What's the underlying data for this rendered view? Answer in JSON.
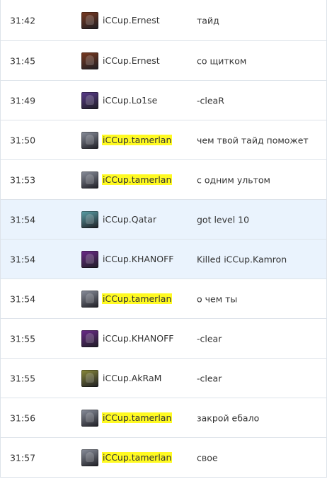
{
  "rows": [
    {
      "time": "31:42",
      "player": "iCCup.Ernest",
      "message": "тайд",
      "icon": "hero-icon-ernest",
      "highlight": false,
      "system": false,
      "color": "#7a3a20"
    },
    {
      "time": "31:45",
      "player": "iCCup.Ernest",
      "message": "со щитком",
      "icon": "hero-icon-ernest",
      "highlight": false,
      "system": false,
      "color": "#7a3a20"
    },
    {
      "time": "31:49",
      "player": "iCCup.Lo1se",
      "message": "-cleaR",
      "icon": "hero-icon-lo1se",
      "highlight": false,
      "system": false,
      "color": "#5a3b8c"
    },
    {
      "time": "31:50",
      "player": "iCCup.tamerlan",
      "message": "чем твой тайд поможет",
      "icon": "hero-icon-tamerlan",
      "highlight": true,
      "system": false,
      "color": "#8a8f9c"
    },
    {
      "time": "31:53",
      "player": "iCCup.tamerlan",
      "message": "с одним ультом",
      "icon": "hero-icon-tamerlan",
      "highlight": true,
      "system": false,
      "color": "#8a8f9c"
    },
    {
      "time": "31:54",
      "player": "iCCup.Qatar",
      "message": "got level 10",
      "icon": "hero-icon-qatar",
      "highlight": false,
      "system": true,
      "color": "#5aa0a8"
    },
    {
      "time": "31:54",
      "player": "iCCup.KHANOFF",
      "message": "Killed iCCup.Kamron",
      "icon": "hero-icon-khanoff",
      "highlight": false,
      "system": true,
      "color": "#6b2a8a"
    },
    {
      "time": "31:54",
      "player": "iCCup.tamerlan",
      "message": "о чем ты",
      "icon": "hero-icon-tamerlan",
      "highlight": true,
      "system": false,
      "color": "#8a8f9c"
    },
    {
      "time": "31:55",
      "player": "iCCup.KHANOFF",
      "message": "-clear",
      "icon": "hero-icon-khanoff",
      "highlight": false,
      "system": false,
      "color": "#6b2a8a"
    },
    {
      "time": "31:55",
      "player": "iCCup.AkRaM",
      "message": "-clear",
      "icon": "hero-icon-akram",
      "highlight": false,
      "system": false,
      "color": "#8a8a3a"
    },
    {
      "time": "31:56",
      "player": "iCCup.tamerlan",
      "message": "закрой ебало",
      "icon": "hero-icon-tamerlan",
      "highlight": true,
      "system": false,
      "color": "#8a8f9c"
    },
    {
      "time": "31:57",
      "player": "iCCup.tamerlan",
      "message": "свое",
      "icon": "hero-icon-tamerlan",
      "highlight": true,
      "system": false,
      "color": "#8a8f9c"
    }
  ]
}
